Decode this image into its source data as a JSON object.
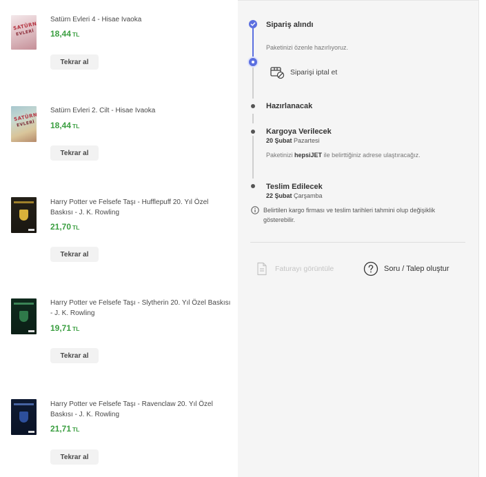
{
  "items": [
    {
      "title": "Satürn Evleri 4 - Hisae Ivaoka",
      "price": "18,44",
      "currency": "TL",
      "button": "Tekrar al",
      "cover": "manga-pink"
    },
    {
      "title": "Satürn Evleri 2. Cilt - Hisae Ivaoka",
      "price": "18,44",
      "currency": "TL",
      "button": "Tekrar al",
      "cover": "manga-blue"
    },
    {
      "title": "Harry Potter ve Felsefe Taşı - Hufflepuff 20. Yıl Özel Baskısı - J. K. Rowling",
      "price": "21,70",
      "currency": "TL",
      "button": "Tekrar al",
      "cover": "hp-hufflepuff"
    },
    {
      "title": "Harry Potter ve Felsefe Taşı - Slytherin 20. Yıl Özel Baskısı - J. K. Rowling",
      "price": "19,71",
      "currency": "TL",
      "button": "Tekrar al",
      "cover": "hp-slytherin"
    },
    {
      "title": "Harry Potter ve Felsefe Taşı - Ravenclaw 20. Yıl Özel Baskısı - J. K. Rowling",
      "price": "21,71",
      "currency": "TL",
      "button": "Tekrar al",
      "cover": "hp-ravenclaw"
    }
  ],
  "timeline": {
    "received": {
      "title": "Sipariş alındı",
      "text": "Paketinizi özenle hazırlıyoruz."
    },
    "cancel_label": "Siparişi iptal et",
    "preparing": {
      "title": "Hazırlanacak"
    },
    "shipping": {
      "title": "Kargoya Verilecek",
      "date_bold": "20 Şubat",
      "date_day": "Pazartesi",
      "text_before": "Paketinizi",
      "carrier": "hepsiJET",
      "text_after": "ile belirttiğiniz adrese ulaştıracağız."
    },
    "delivery": {
      "title": "Teslim Edilecek",
      "date_bold": "22 Şubat",
      "date_day": "Çarşamba"
    },
    "info": "Belirtilen kargo firması ve teslim tarihleri tahmini olup değişiklik gösterebilir."
  },
  "actions": {
    "invoice_label": "Faturayı görüntüle",
    "ticket_label": "Soru / Talep oluştur"
  },
  "colors": {
    "price_green": "#3a9e40",
    "accent_blue": "#5b6fe0",
    "panel_bg": "#f5f5f5"
  }
}
